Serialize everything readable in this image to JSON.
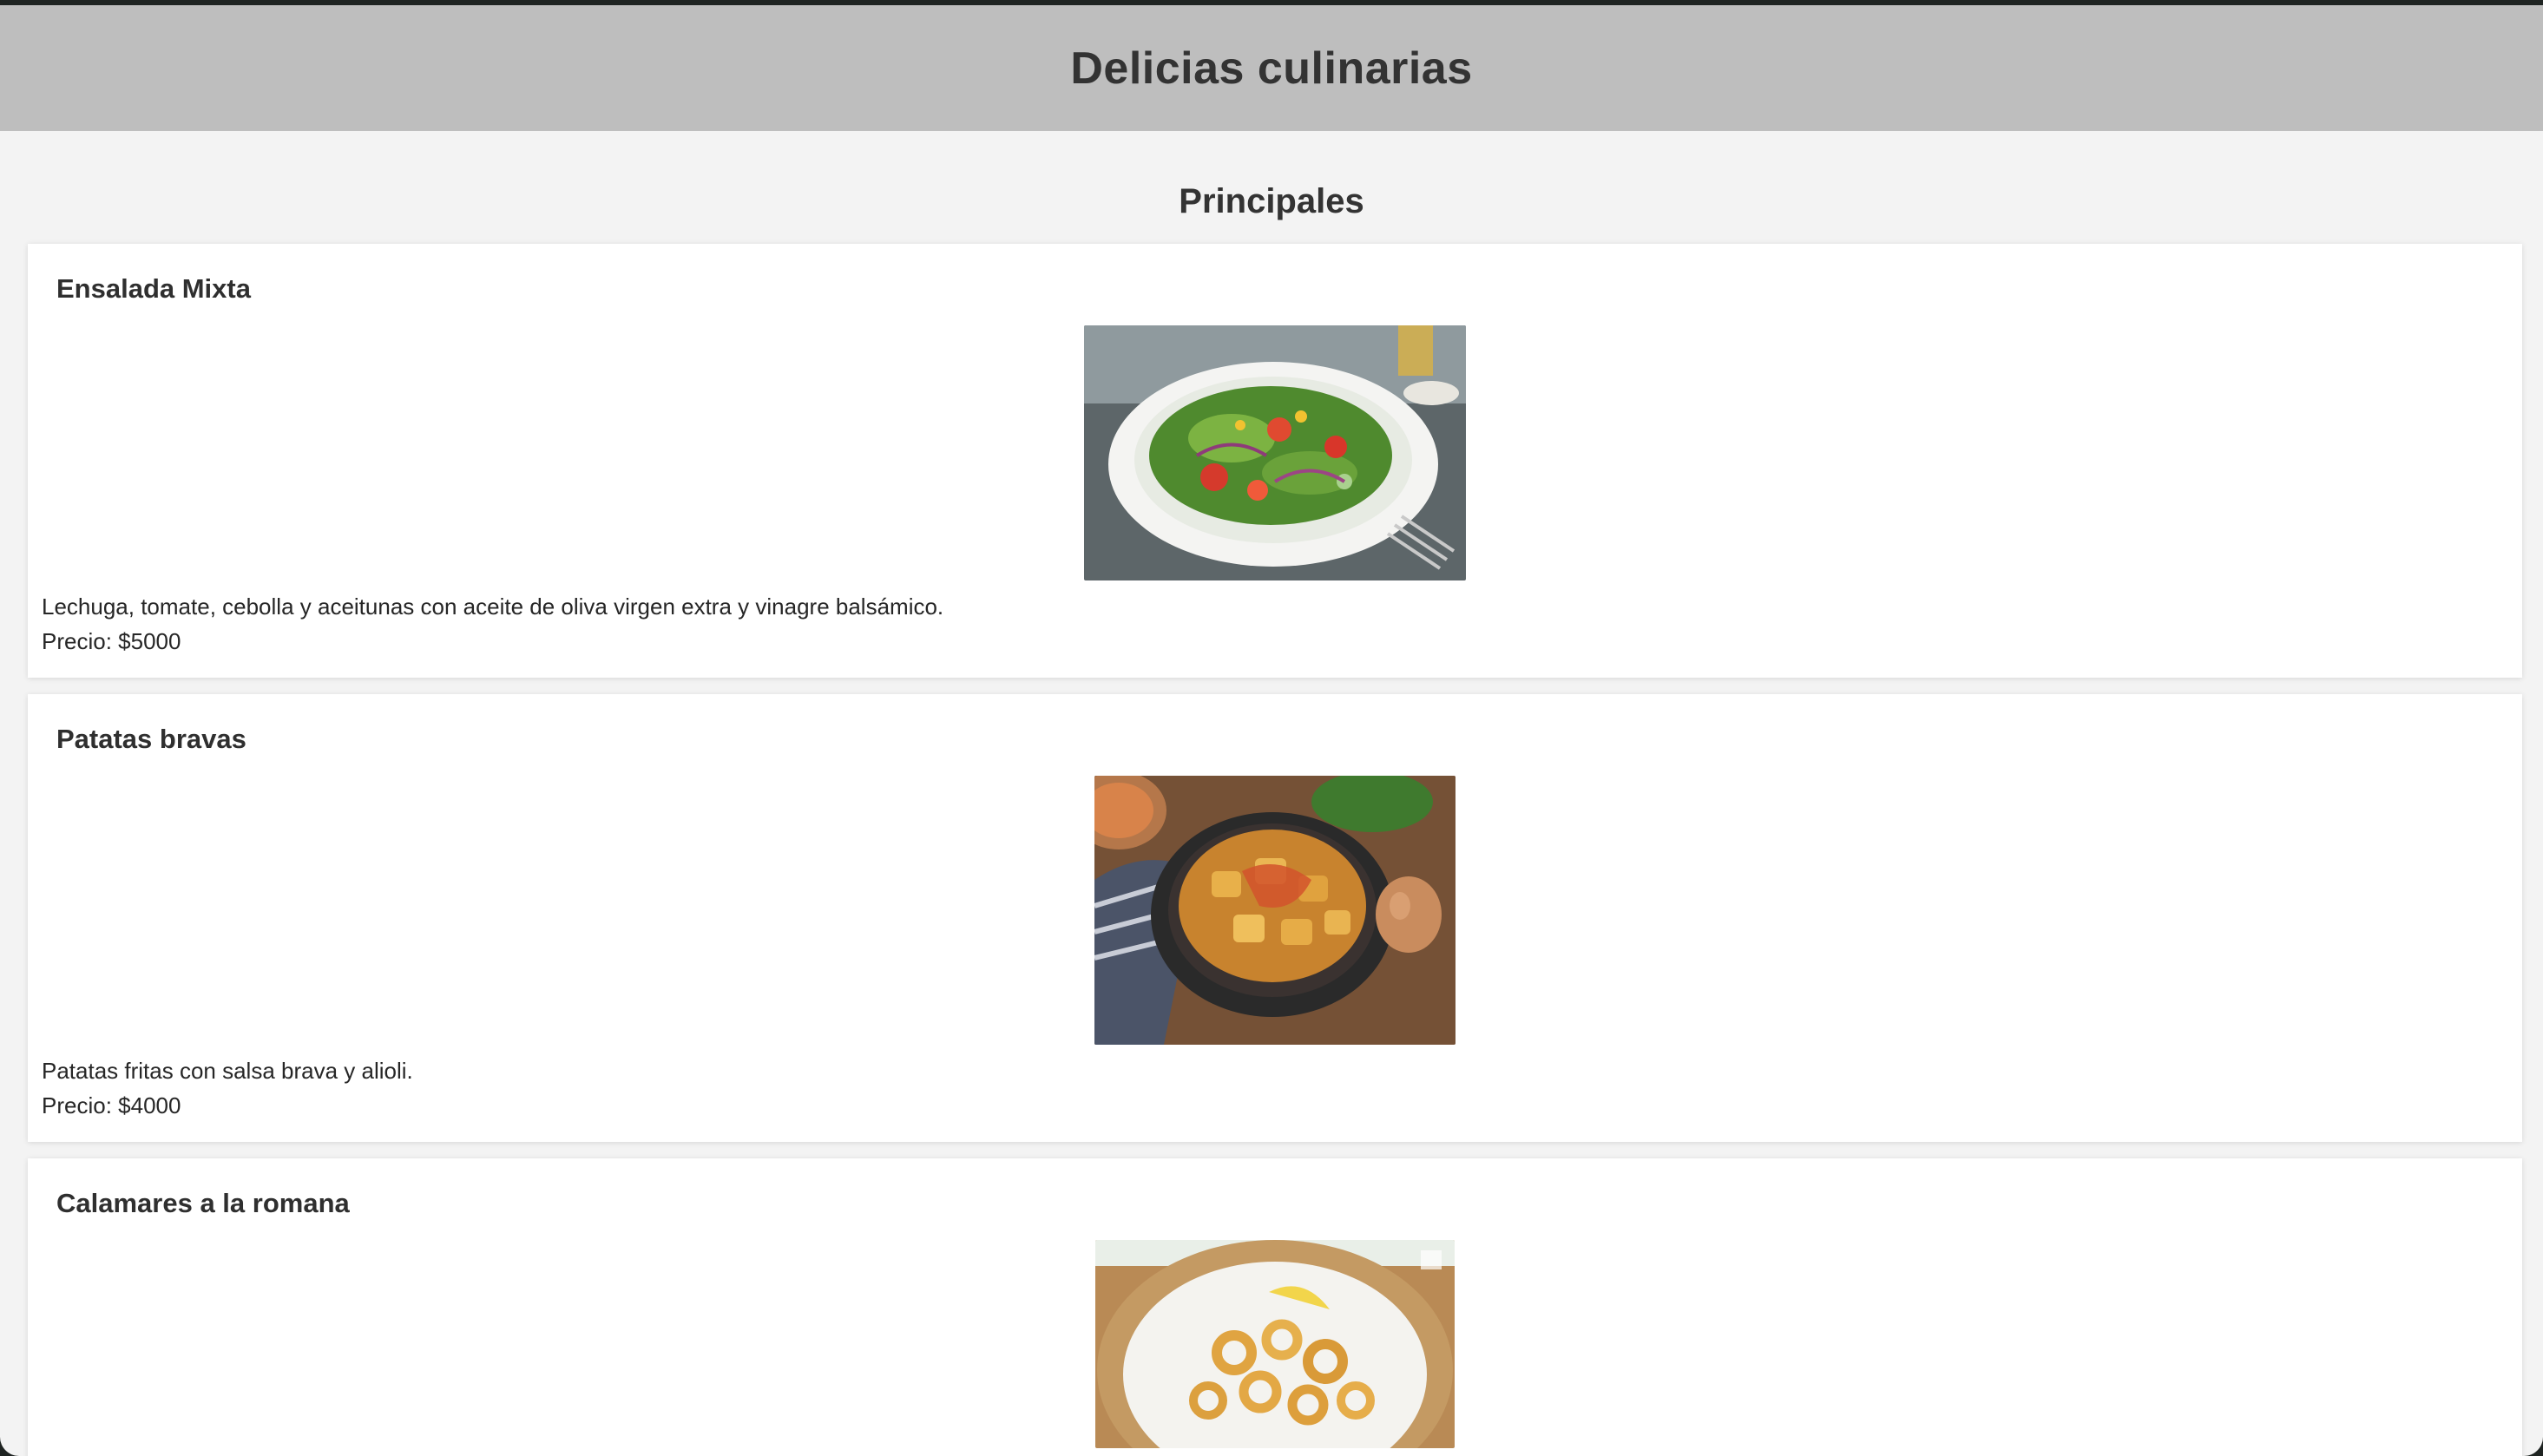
{
  "site": {
    "title": "Delicias culinarias"
  },
  "section": {
    "title": "Principales"
  },
  "dishes": [
    {
      "name": "Ensalada Mixta",
      "description": "Lechuga, tomate, cebolla y aceitunas con aceite de oliva virgen extra y vinagre balsámico.",
      "price": "Precio: $5000",
      "image_icon": "salad-photo"
    },
    {
      "name": "Patatas bravas",
      "description": "Patatas fritas con salsa brava y alioli.",
      "price": "Precio: $4000",
      "image_icon": "patatas-bravas-photo"
    },
    {
      "name": "Calamares a la romana",
      "image_icon": "calamares-photo"
    }
  ]
}
